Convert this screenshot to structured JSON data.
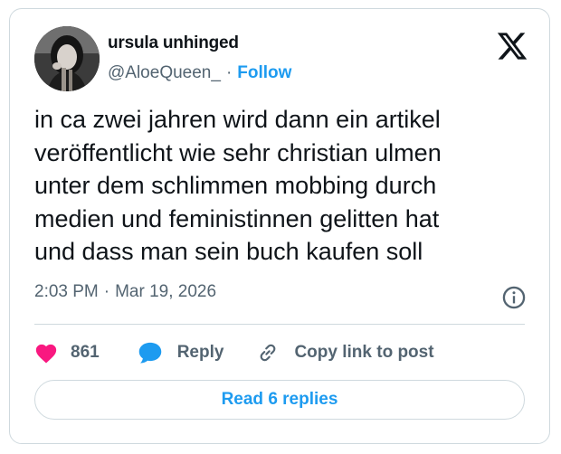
{
  "author": {
    "display_name": "ursula unhinged",
    "handle": "@AloeQueen_",
    "separator": "·",
    "follow_label": "Follow"
  },
  "tweet": {
    "lines": [
      "in ca zwei jahren wird dann ein artikel",
      "veröffentlicht wie sehr christian ulmen",
      "unter dem schlimmen mobbing durch",
      "medien und feministinnen gelitten hat",
      "und dass man sein buch kaufen soll"
    ]
  },
  "meta": {
    "time": "2:03 PM",
    "separator": "·",
    "date": "Mar 19, 2026"
  },
  "actions": {
    "like_count": "861",
    "reply_label": "Reply",
    "copy_label": "Copy link to post"
  },
  "footer": {
    "read_replies_label": "Read 6 replies"
  },
  "icons": {
    "brand": "x-logo-icon",
    "info": "info-icon",
    "like": "heart-icon",
    "reply": "speech-bubble-icon",
    "copy": "link-icon"
  },
  "colors": {
    "accent": "#1d9bf0",
    "like": "#f91880",
    "text": "#0f1419",
    "muted": "#536471",
    "border": "#cfd9de"
  }
}
